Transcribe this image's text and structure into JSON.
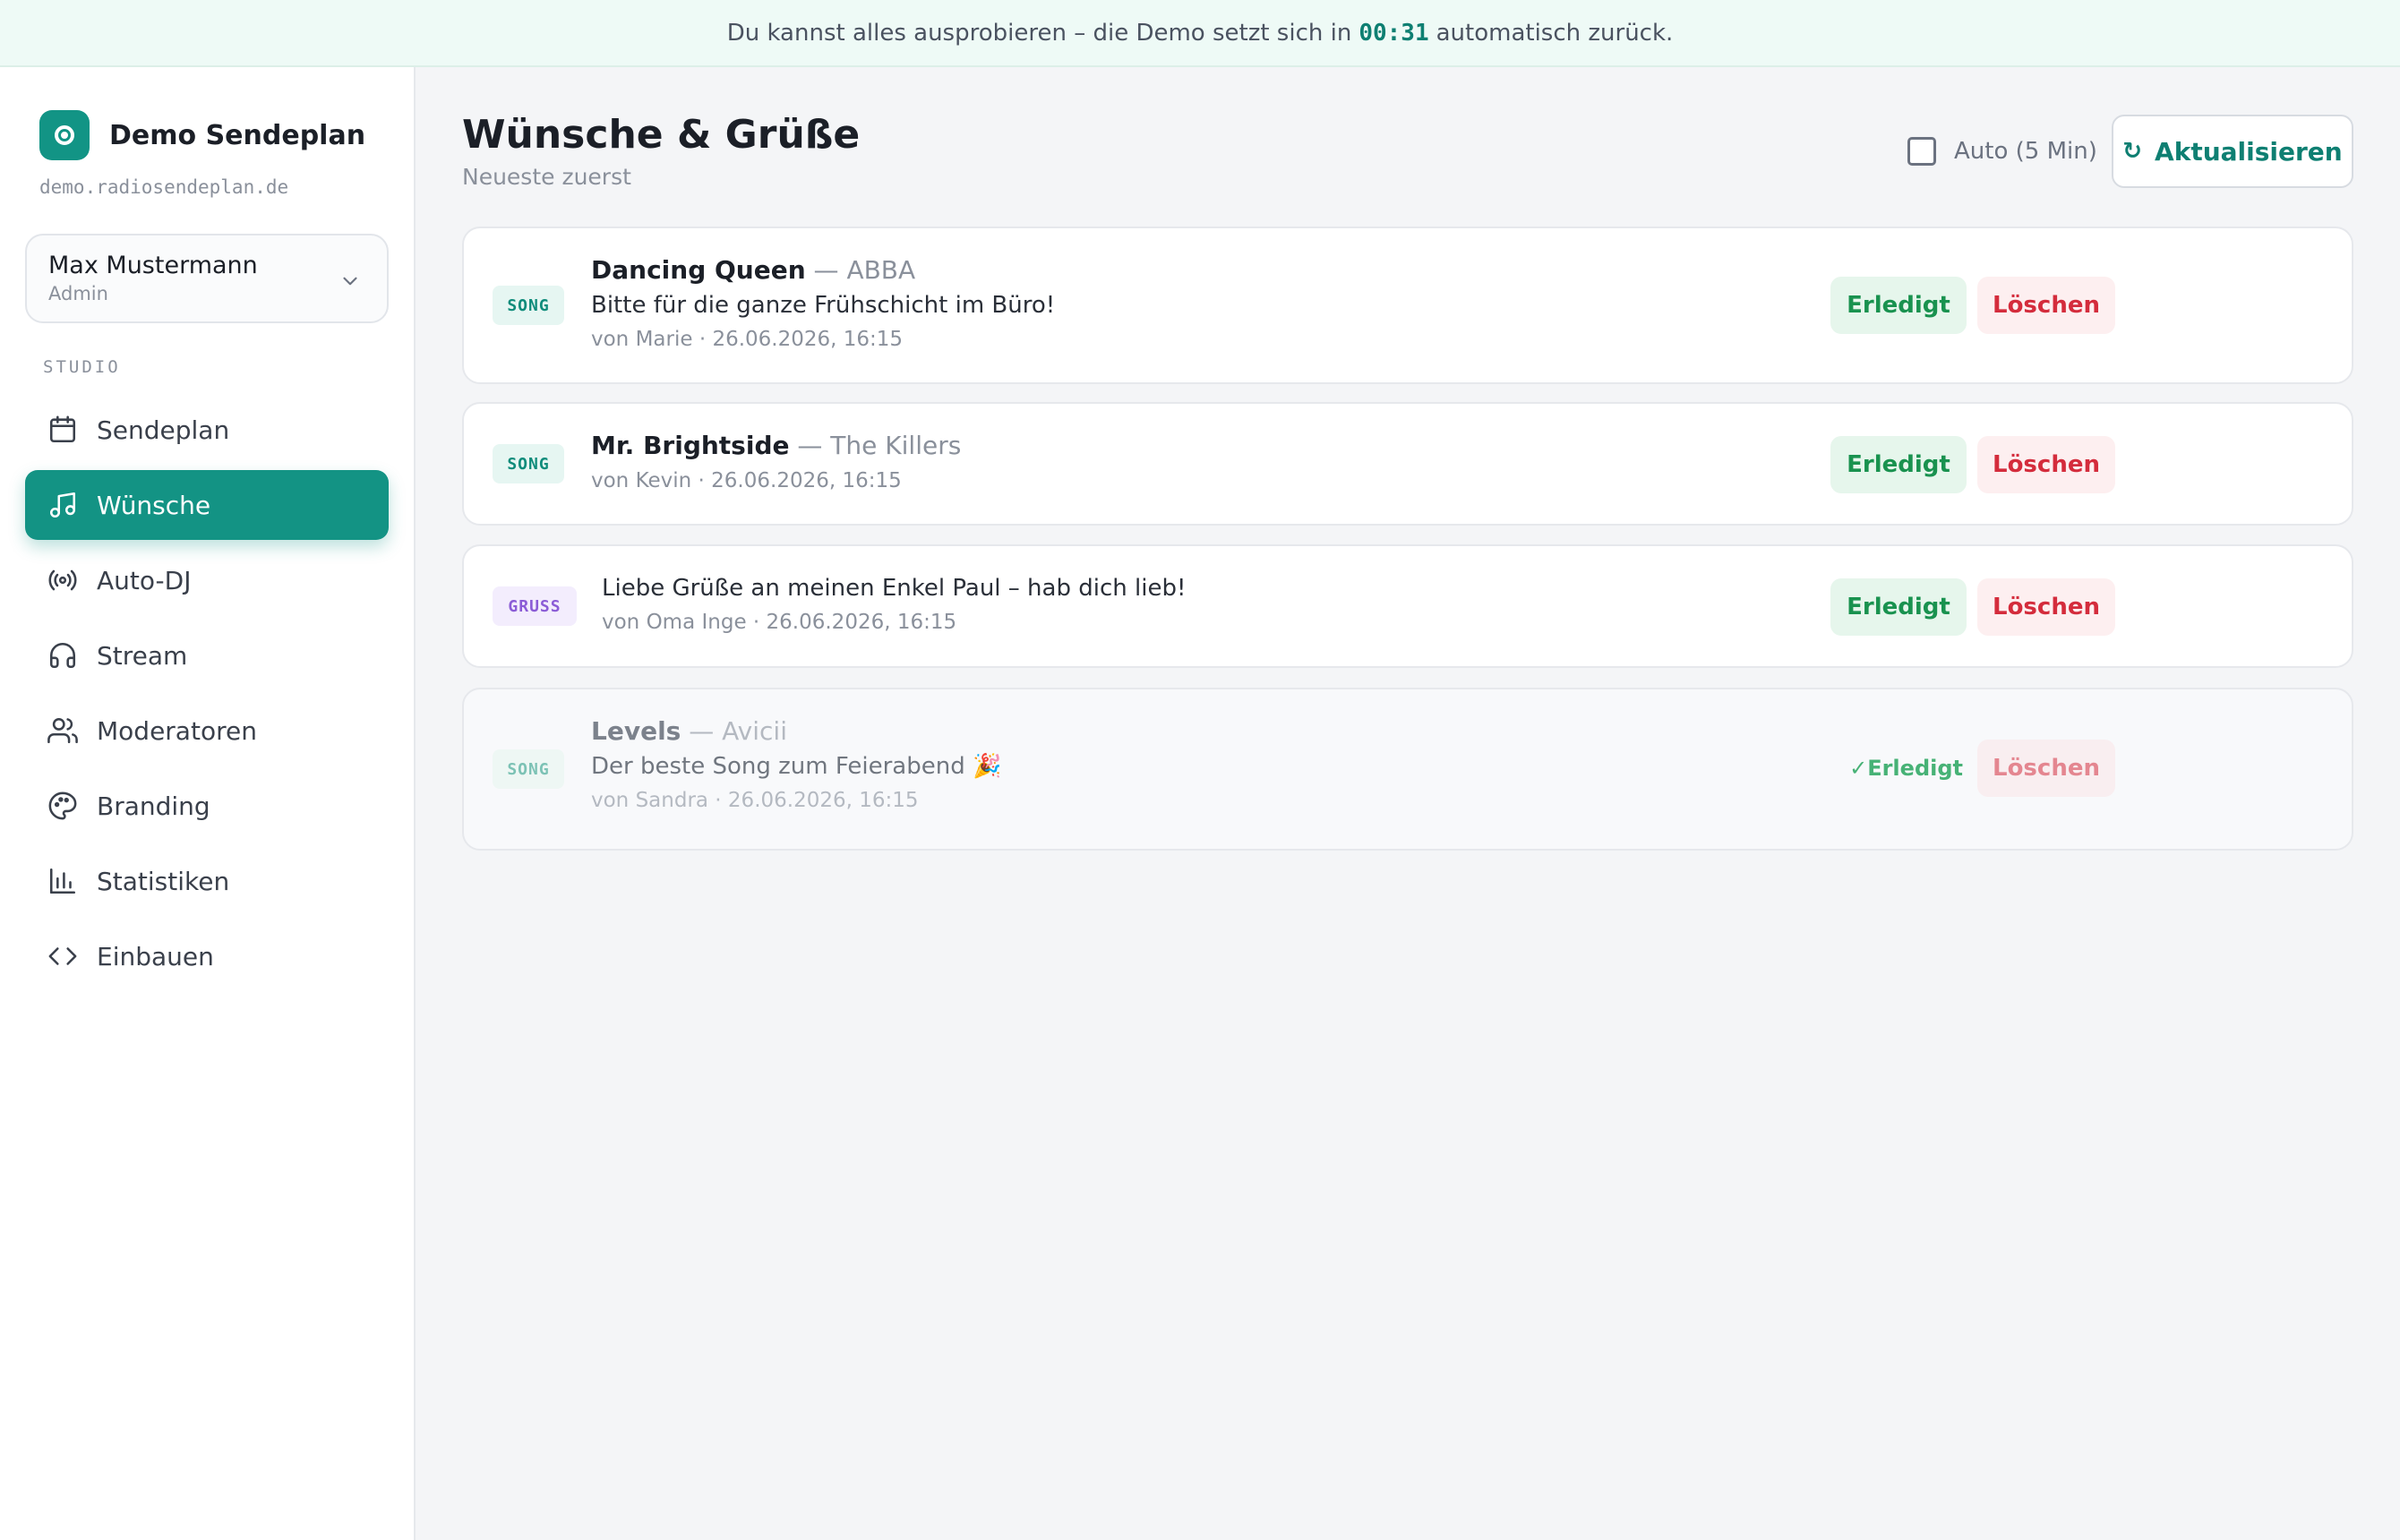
{
  "banner": {
    "text_before": "Du kannst alles ausprobieren – die Demo setzt sich in",
    "timer": "00:31",
    "text_after": "automatisch zurück."
  },
  "sidebar": {
    "brand_name": "Demo Sendeplan",
    "brand_domain": "demo.radiosendeplan.de",
    "user": {
      "name": "Max Mustermann",
      "role": "Admin"
    },
    "section_label": "STUDIO",
    "items": [
      {
        "label": "Sendeplan",
        "icon": "calendar-icon",
        "active": false
      },
      {
        "label": "Wünsche",
        "icon": "music-note-icon",
        "active": true
      },
      {
        "label": "Auto-DJ",
        "icon": "broadcast-icon",
        "active": false
      },
      {
        "label": "Stream",
        "icon": "headphones-icon",
        "active": false
      },
      {
        "label": "Moderatoren",
        "icon": "users-icon",
        "active": false
      },
      {
        "label": "Branding",
        "icon": "palette-icon",
        "active": false
      },
      {
        "label": "Statistiken",
        "icon": "bar-chart-icon",
        "active": false
      },
      {
        "label": "Einbauen",
        "icon": "code-icon",
        "active": false
      }
    ]
  },
  "main": {
    "title": "Wünsche & Grüße",
    "subtitle": "Neueste zuerst",
    "auto_label": "Auto (5 Min)",
    "refresh_icon": "↻",
    "refresh_label": "Aktualisieren",
    "done_label": "Erledigt",
    "delete_label": "Löschen",
    "done_status_label": "✓Erledigt",
    "requests": [
      {
        "type": "SONG",
        "title": "Dancing Queen",
        "artist": "— ABBA",
        "message": "Bitte für die ganze Frühschicht im Büro!",
        "meta": "von Marie · 26.06.2026, 16:15",
        "done": false
      },
      {
        "type": "SONG",
        "title": "Mr. Brightside",
        "artist": "— The Killers",
        "message": "",
        "meta": "von Kevin · 26.06.2026, 16:15",
        "done": false
      },
      {
        "type": "GRUSS",
        "title": "",
        "artist": "",
        "message": "Liebe Grüße an meinen Enkel Paul – hab dich lieb!",
        "meta": "von Oma Inge · 26.06.2026, 16:15",
        "done": false
      },
      {
        "type": "SONG",
        "title": "Levels",
        "artist": "— Avicii",
        "message": "Der beste Song zum Feierabend 🎉",
        "meta": "von Sandra · 26.06.2026, 16:15",
        "done": true
      }
    ]
  }
}
